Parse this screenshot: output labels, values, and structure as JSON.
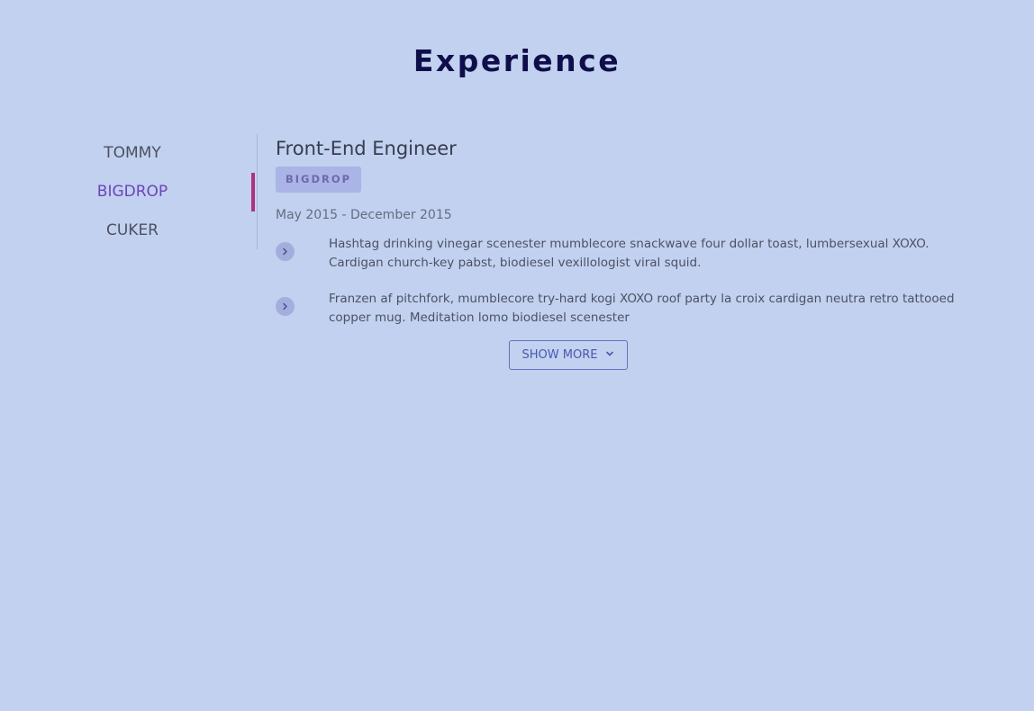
{
  "section": {
    "title": "Experience"
  },
  "tabs": [
    {
      "label": "TOMMY",
      "active": false
    },
    {
      "label": "BIGDROP",
      "active": true
    },
    {
      "label": "CUKER",
      "active": false
    }
  ],
  "job": {
    "title": "Front-End Engineer",
    "company": "BIGDROP",
    "dates": "May 2015 - December 2015",
    "bullets": [
      "Hashtag drinking vinegar scenester mumblecore snackwave four dollar toast, lumbersexual XOXO. Cardigan church-key pabst, biodiesel vexillologist viral squid.",
      "Franzen af pitchfork, mumblecore try-hard kogi XOXO roof party la croix cardigan neutra retro tattooed copper mug. Meditation lomo biodiesel scenester"
    ]
  },
  "show_more": {
    "label": "SHOW MORE",
    "icon": "chevron-down-icon"
  },
  "colors": {
    "background": "#c1d1ef",
    "title": "#0f0e4a",
    "active_tab": "#6b45b8",
    "indicator": "#b0307e",
    "badge_bg": "#aab4e6",
    "button_border": "#6373c4"
  }
}
